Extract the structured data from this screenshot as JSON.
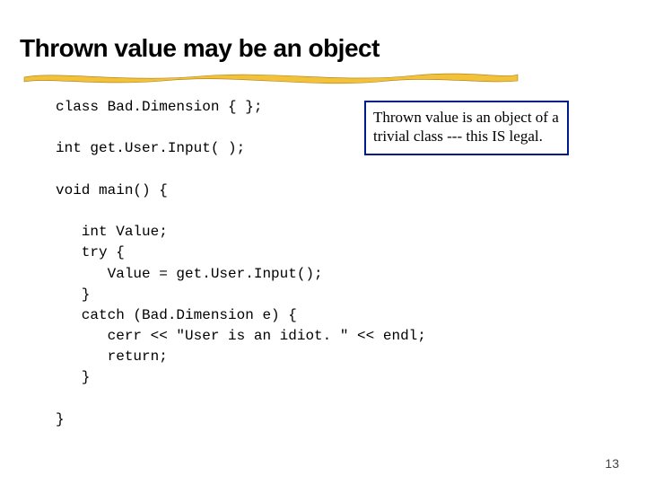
{
  "title": "Thrown value may be an object",
  "code": "class Bad.Dimension { };\n\nint get.User.Input( );\n\nvoid main() {\n\n   int Value;\n   try {\n      Value = get.User.Input();\n   }\n   catch (Bad.Dimension e) {\n      cerr << \"User is an idiot. \" << endl;\n      return;\n   }\n\n}",
  "callout": "Thrown value is an object of a trivial class --- this IS legal.",
  "page_number": "13",
  "colors": {
    "underline_fill": "#f2c23a",
    "underline_stroke": "#a87b12",
    "callout_border": "#001a8a"
  }
}
